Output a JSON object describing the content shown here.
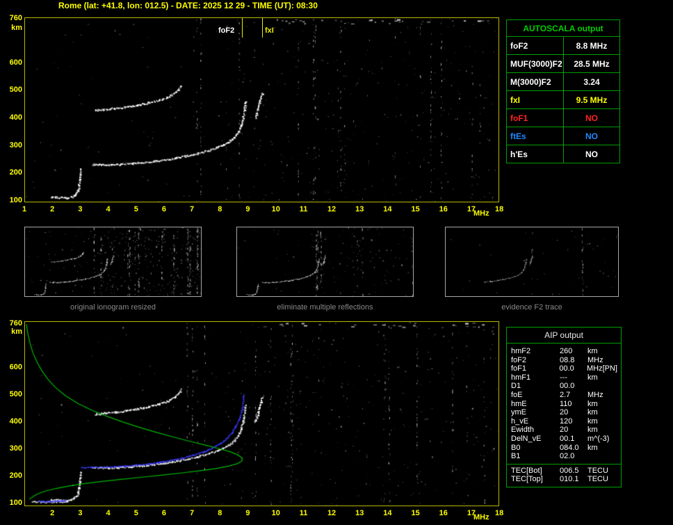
{
  "header": {
    "title": "Rome (lat: +41.8, lon: 012.5) - DATE: 2025 12 29 - TIME (UT): 08:30"
  },
  "colors": {
    "axis": "#ffff00",
    "plot_border": "#b8b800",
    "table_border": "#00a000",
    "profile_green": "#00bb00",
    "fitted_blue": "#3a3aff",
    "caption_gray": "#8a8a8a"
  },
  "autoscala_table": {
    "title": "AUTOSCALA output",
    "rows": [
      {
        "label": "foF2",
        "value": "8.8 MHz",
        "color": "#ffffff",
        "value_color": "#ffffff"
      },
      {
        "label": "MUF(3000)F2",
        "value": "28.5 MHz",
        "color": "#ffffff",
        "value_color": "#ffffff"
      },
      {
        "label": "M(3000)F2",
        "value": "3.24",
        "color": "#ffffff",
        "value_color": "#ffffff"
      },
      {
        "label": "fxI",
        "value": "9.5 MHz",
        "color": "#ffff00",
        "value_color": "#ffff00"
      },
      {
        "label": "foF1",
        "value": "NO",
        "color": "#ff2222",
        "value_color": "#ff2222"
      },
      {
        "label": "ftEs",
        "value": "NO",
        "color": "#2288ff",
        "value_color": "#2288ff"
      },
      {
        "label": "h'Es",
        "value": "NO",
        "color": "#ffffff",
        "value_color": "#ffffff"
      }
    ]
  },
  "thumbnails": [
    {
      "caption": "original ionogram resized",
      "series": [
        "E_trace",
        "F2_trace",
        "second_hop",
        "x_mode"
      ],
      "noise": 0.8
    },
    {
      "caption": "eliminate multiple reflections",
      "series": [
        "E_trace",
        "F2_trace",
        "x_mode"
      ],
      "noise": 0.35
    },
    {
      "caption": "evidence F2 trace",
      "series": [
        "F2_right",
        "x_mode"
      ],
      "noise": 0.12
    }
  ],
  "aip_table": {
    "title": "AIP output",
    "rows": [
      {
        "name": "hmF2",
        "value": "260",
        "unit": "km"
      },
      {
        "name": "foF2",
        "value": "08.8",
        "unit": "MHz"
      },
      {
        "name": "foF1",
        "value": "00.0",
        "unit": "MHz",
        "note": "[PN]"
      },
      {
        "name": "hmF1",
        "value": "---",
        "unit": "km"
      },
      {
        "name": "D1",
        "value": "00.0",
        "unit": ""
      },
      {
        "name": "foE",
        "value": "2.7",
        "unit": "MHz"
      },
      {
        "name": "hmE",
        "value": "110",
        "unit": "km"
      },
      {
        "name": "ymE",
        "value": "20",
        "unit": "km"
      },
      {
        "name": "h_vE",
        "value": "120",
        "unit": "km"
      },
      {
        "name": "Ewidth",
        "value": "20",
        "unit": "km"
      },
      {
        "name": "DelN_vE",
        "value": "00.1",
        "unit": "m^(-3)"
      },
      {
        "name": "B0",
        "value": "084.0",
        "unit": "km"
      },
      {
        "name": "B1",
        "value": "02.0",
        "unit": ""
      }
    ],
    "tec_rows": [
      {
        "name": "TEC[Bot]",
        "value": "006.5",
        "unit": "TECU"
      },
      {
        "name": "TEC[Top]",
        "value": "010.1",
        "unit": "TECU"
      }
    ]
  },
  "chart_data": [
    {
      "id": "ionogram_autoscala",
      "type": "scatter",
      "title": "",
      "xlabel": "MHz",
      "ylabel": "km",
      "xlim": [
        1,
        18
      ],
      "ylim": [
        90,
        760
      ],
      "x_ticks": [
        1,
        2,
        3,
        4,
        5,
        6,
        7,
        8,
        9,
        10,
        11,
        12,
        13,
        14,
        15,
        16,
        17,
        18
      ],
      "y_ticks": [
        760,
        600,
        500,
        400,
        300,
        200,
        100
      ],
      "grid": false,
      "legend": false,
      "markers": [
        {
          "label": "foF2",
          "x": 8.8,
          "label_color": "#ffffff",
          "line_color": "#eeee00",
          "label_offset": -34
        },
        {
          "label": "fxI",
          "x": 9.5,
          "label_color": "#eeee00",
          "line_color": "#eeee00",
          "label_offset": 4
        }
      ],
      "series": [
        {
          "name": "E_trace",
          "color": "#ffffff",
          "points": [
            [
              1.9,
              108
            ],
            [
              2.1,
              107
            ],
            [
              2.3,
              106
            ],
            [
              2.5,
              106
            ],
            [
              2.65,
              109
            ],
            [
              2.75,
              114
            ],
            [
              2.82,
              122
            ],
            [
              2.88,
              134
            ],
            [
              2.92,
              152
            ],
            [
              2.95,
              172
            ],
            [
              2.97,
              192
            ],
            [
              2.98,
              212
            ]
          ]
        },
        {
          "name": "F2_trace",
          "color": "#ffffff",
          "points": [
            [
              3.4,
              228
            ],
            [
              3.7,
              226
            ],
            [
              4.0,
              226
            ],
            [
              4.4,
              228
            ],
            [
              4.8,
              231
            ],
            [
              5.2,
              234
            ],
            [
              5.6,
              239
            ],
            [
              6.0,
              244
            ],
            [
              6.4,
              251
            ],
            [
              6.8,
              259
            ],
            [
              7.2,
              268
            ],
            [
              7.6,
              279
            ],
            [
              8.0,
              294
            ],
            [
              8.3,
              310
            ],
            [
              8.5,
              327
            ],
            [
              8.65,
              347
            ],
            [
              8.75,
              372
            ],
            [
              8.82,
              402
            ],
            [
              8.87,
              432
            ],
            [
              8.9,
              458
            ]
          ]
        },
        {
          "name": "second_hop",
          "color": "#ffffff",
          "points": [
            [
              3.5,
              425
            ],
            [
              3.8,
              428
            ],
            [
              4.2,
              432
            ],
            [
              4.6,
              437
            ],
            [
              5.0,
              444
            ],
            [
              5.4,
              452
            ],
            [
              5.8,
              462
            ],
            [
              6.1,
              473
            ],
            [
              6.35,
              487
            ],
            [
              6.5,
              501
            ],
            [
              6.6,
              516
            ]
          ]
        },
        {
          "name": "x_mode",
          "color": "#ffffff",
          "points": [
            [
              9.25,
              398
            ],
            [
              9.3,
              414
            ],
            [
              9.35,
              430
            ],
            [
              9.4,
              450
            ],
            [
              9.45,
              470
            ],
            [
              9.5,
              490
            ]
          ]
        },
        {
          "name": "F2_right",
          "color": "#ffffff",
          "thumb_only": true,
          "points": [
            [
              4.8,
              231
            ],
            [
              5.4,
              237
            ],
            [
              6.0,
              244
            ],
            [
              6.6,
              256
            ],
            [
              7.2,
              268
            ],
            [
              7.8,
              285
            ],
            [
              8.3,
              310
            ],
            [
              8.6,
              340
            ],
            [
              8.75,
              372
            ],
            [
              8.85,
              415
            ],
            [
              8.9,
              455
            ]
          ]
        }
      ]
    },
    {
      "id": "ionogram_inversion",
      "type": "scatter",
      "title": "",
      "xlabel": "MHz",
      "ylabel": "km",
      "xlim": [
        1,
        18
      ],
      "ylim": [
        85,
        765
      ],
      "x_ticks": [
        2,
        3,
        4,
        5,
        6,
        7,
        8,
        9,
        10,
        11,
        12,
        13,
        14,
        15,
        16,
        17,
        18
      ],
      "y_ticks": [
        760,
        600,
        500,
        400,
        300,
        200,
        100
      ],
      "grid": false,
      "legend": false,
      "series": [
        {
          "name": "Es_trace",
          "color": "#ffffff",
          "points": [
            [
              1.25,
              100
            ],
            [
              1.5,
              101
            ],
            [
              1.75,
              100
            ],
            [
              2.0,
              102
            ],
            [
              2.25,
              101
            ],
            [
              2.5,
              103
            ]
          ]
        },
        {
          "name": "E_trace",
          "color": "#ffffff",
          "points": [
            [
              1.9,
              108
            ],
            [
              2.1,
              107
            ],
            [
              2.3,
              106
            ],
            [
              2.5,
              106
            ],
            [
              2.65,
              109
            ],
            [
              2.75,
              114
            ],
            [
              2.82,
              122
            ],
            [
              2.88,
              134
            ],
            [
              2.92,
              152
            ],
            [
              2.95,
              172
            ],
            [
              2.97,
              192
            ],
            [
              2.98,
              212
            ]
          ]
        },
        {
          "name": "F2_trace",
          "color": "#ffffff",
          "points": [
            [
              3.4,
              228
            ],
            [
              3.7,
              226
            ],
            [
              4.0,
              226
            ],
            [
              4.4,
              228
            ],
            [
              4.8,
              231
            ],
            [
              5.2,
              234
            ],
            [
              5.6,
              239
            ],
            [
              6.0,
              244
            ],
            [
              6.4,
              251
            ],
            [
              6.8,
              259
            ],
            [
              7.2,
              268
            ],
            [
              7.6,
              279
            ],
            [
              8.0,
              294
            ],
            [
              8.3,
              310
            ],
            [
              8.5,
              327
            ],
            [
              8.65,
              347
            ],
            [
              8.75,
              372
            ],
            [
              8.82,
              402
            ],
            [
              8.87,
              432
            ],
            [
              8.9,
              458
            ]
          ]
        },
        {
          "name": "second_hop",
          "color": "#ffffff",
          "points": [
            [
              3.5,
              425
            ],
            [
              3.8,
              428
            ],
            [
              4.2,
              432
            ],
            [
              4.6,
              437
            ],
            [
              5.0,
              444
            ],
            [
              5.4,
              452
            ],
            [
              5.8,
              462
            ],
            [
              6.1,
              473
            ],
            [
              6.35,
              487
            ],
            [
              6.5,
              501
            ],
            [
              6.6,
              516
            ]
          ]
        },
        {
          "name": "x_mode",
          "color": "#ffffff",
          "points": [
            [
              9.25,
              398
            ],
            [
              9.3,
              414
            ],
            [
              9.35,
              430
            ],
            [
              9.4,
              450
            ],
            [
              9.45,
              470
            ],
            [
              9.5,
              490
            ]
          ]
        }
      ],
      "overlays": [
        {
          "name": "fitted_trace_E",
          "type": "dots",
          "color": "#3a3aff",
          "points": [
            [
              1.45,
              103
            ],
            [
              1.7,
              102
            ],
            [
              1.95,
              102
            ],
            [
              2.2,
              103
            ],
            [
              2.45,
              104
            ]
          ]
        },
        {
          "name": "fitted_trace_F",
          "type": "dots",
          "color": "#3a3aff",
          "points": [
            [
              3.0,
              228
            ],
            [
              3.4,
              228
            ],
            [
              3.8,
              229
            ],
            [
              4.2,
              231
            ],
            [
              4.6,
              233
            ],
            [
              5.0,
              237
            ],
            [
              5.4,
              241
            ],
            [
              5.8,
              247
            ],
            [
              6.2,
              254
            ],
            [
              6.6,
              262
            ],
            [
              7.0,
              273
            ],
            [
              7.4,
              286
            ],
            [
              7.7,
              300
            ],
            [
              8.0,
              317
            ],
            [
              8.2,
              334
            ],
            [
              8.4,
              356
            ],
            [
              8.55,
              381
            ],
            [
              8.7,
              412
            ],
            [
              8.78,
              443
            ],
            [
              8.82,
              472
            ],
            [
              8.84,
              498
            ]
          ]
        },
        {
          "name": "electron_density_profile",
          "type": "line",
          "color": "#00bb00",
          "points": [
            [
              1.05,
              757
            ],
            [
              1.1,
              722
            ],
            [
              1.18,
              686
            ],
            [
              1.28,
              652
            ],
            [
              1.42,
              618
            ],
            [
              1.6,
              585
            ],
            [
              1.82,
              553
            ],
            [
              2.1,
              522
            ],
            [
              2.45,
              492
            ],
            [
              2.9,
              463
            ],
            [
              3.4,
              438
            ],
            [
              3.95,
              415
            ],
            [
              4.55,
              393
            ],
            [
              5.15,
              373
            ],
            [
              5.75,
              355
            ],
            [
              6.35,
              338
            ],
            [
              6.95,
              322
            ],
            [
              7.5,
              308
            ],
            [
              8.0,
              295
            ],
            [
              8.4,
              283
            ],
            [
              8.65,
              272
            ],
            [
              8.8,
              261
            ],
            [
              8.79,
              250
            ],
            [
              8.62,
              240
            ],
            [
              8.3,
              231
            ],
            [
              7.85,
              222
            ],
            [
              7.3,
              214
            ],
            [
              6.65,
              206
            ],
            [
              5.95,
              198
            ],
            [
              5.2,
              190
            ],
            [
              4.45,
              182
            ],
            [
              3.75,
              174
            ],
            [
              3.1,
              166
            ],
            [
              2.55,
              157
            ],
            [
              2.1,
              148
            ],
            [
              1.75,
              139
            ],
            [
              1.5,
              130
            ],
            [
              1.33,
              121
            ],
            [
              1.22,
              113
            ],
            [
              1.16,
              108
            ]
          ]
        }
      ]
    }
  ]
}
